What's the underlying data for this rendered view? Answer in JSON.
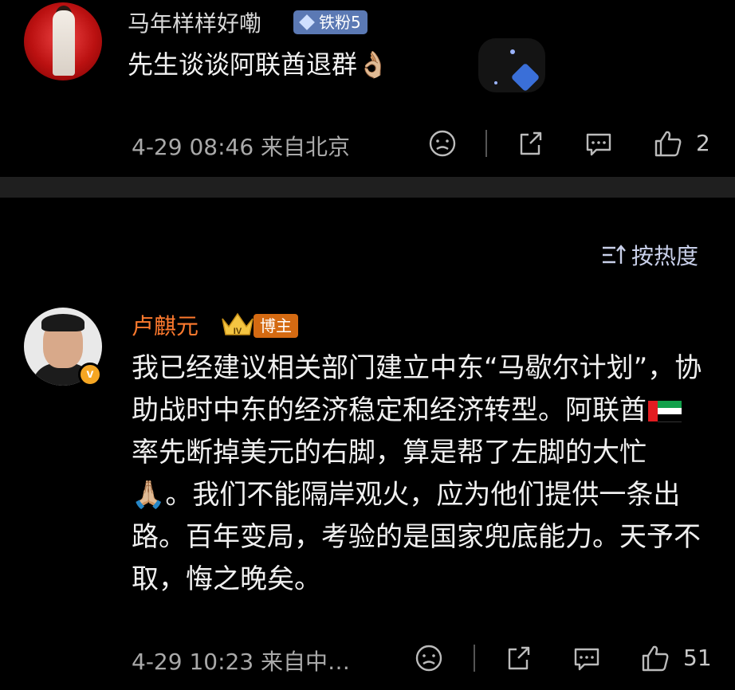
{
  "comment1": {
    "username": "马年样样好嘞",
    "fan_badge": "铁粉5",
    "text": "先生谈谈阿联酋退群👌🏼",
    "meta": "4-29 08:46  来自北京",
    "like_count": "2"
  },
  "sort": {
    "label": "按热度"
  },
  "comment2": {
    "username": "卢麒元",
    "crown_level": "IV",
    "host_badge": "博主",
    "verified_badge": "v",
    "text_part1": "我已经建议相关部门建立中东“马歇尔计划”，协助战时中东的经济稳定和经济转型。阿联酋",
    "text_part2": "率先断掉美元的右脚，算是帮了左脚的大忙🙏🏼。我们不能隔岸观火，应为他们提供一条出路。百年变局，考验的是国家兜底能力。天予不取，悔之晚矣。",
    "meta": "4-29 10:23  来自中…",
    "like_count": "51"
  },
  "colors": {
    "background": "#000000",
    "host_name": "#ff7a2e",
    "fan_badge_bg": "#5b79b4",
    "host_badge_bg": "#d46a12",
    "divider": "#1f1f1f"
  }
}
